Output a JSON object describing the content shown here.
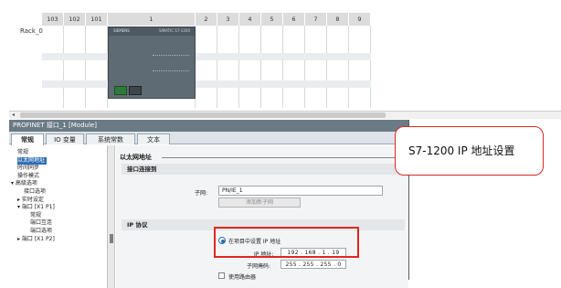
{
  "rack": {
    "label": "Rack_0",
    "slots": [
      "103",
      "102",
      "101",
      "1",
      "2",
      "3",
      "4",
      "5",
      "6",
      "7",
      "8",
      "9"
    ],
    "cpu": {
      "brand": "SIEMENS",
      "model": "SIMATIC S7-1200"
    }
  },
  "properties": {
    "title": "PROFINET 接口_1 [Module]",
    "tabs": [
      "常规",
      "IO 变量",
      "系统常数",
      "文本"
    ],
    "active_tab": "常规",
    "nav": [
      {
        "label": "常规",
        "indent": 1,
        "arrow": ""
      },
      {
        "label": "以太网地址",
        "indent": 1,
        "arrow": "",
        "selected": true
      },
      {
        "label": "时间同步",
        "indent": 1,
        "arrow": ""
      },
      {
        "label": "操作模式",
        "indent": 1,
        "arrow": ""
      },
      {
        "label": "高级选项",
        "indent": 0,
        "arrow": "▾"
      },
      {
        "label": "接口选项",
        "indent": 2,
        "arrow": ""
      },
      {
        "label": "实时设定",
        "indent": 1,
        "arrow": "▸"
      },
      {
        "label": "端口 [X1 P1]",
        "indent": 1,
        "arrow": "▾"
      },
      {
        "label": "常规",
        "indent": 3,
        "arrow": ""
      },
      {
        "label": "端口互连",
        "indent": 3,
        "arrow": ""
      },
      {
        "label": "端口选项",
        "indent": 3,
        "arrow": ""
      },
      {
        "label": "端口 [X1 P2]",
        "indent": 1,
        "arrow": "▸"
      }
    ],
    "content": {
      "section_title": "以太网地址",
      "connect_header": "接口连接到",
      "subnet_label": "子网:",
      "subnet_value": "PN/IE_1",
      "add_subnet_button": "添加新子网",
      "ip_header": "IP 协议",
      "radio_label": "在项目中设置 IP 地址",
      "ip_label": "IP 地址:",
      "ip_value": "192 . 168 . 1 . 19",
      "mask_label": "子网掩码:",
      "mask_value": "255 . 255 . 255 . 0",
      "router_label": "使用路由器"
    }
  },
  "callout": {
    "text": "S7-1200 IP 地址设置"
  },
  "colors": {
    "highlight": "#e0281f",
    "selection": "#2c6db5",
    "title_bar": "#6a7b86"
  }
}
